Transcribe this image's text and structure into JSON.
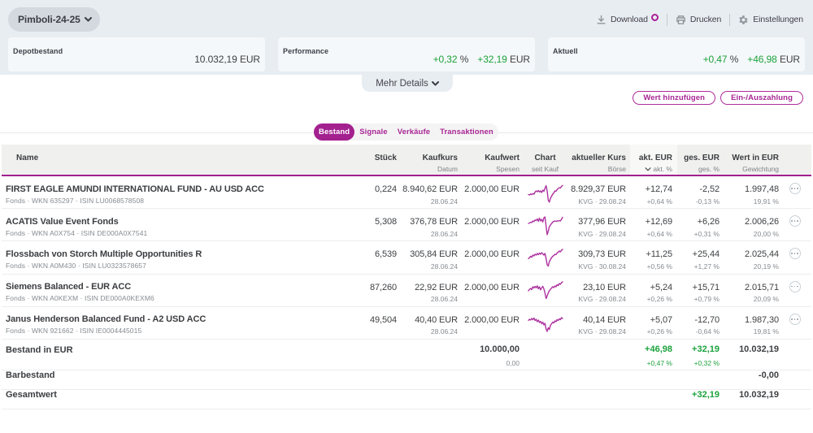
{
  "brand": {
    "magenta": "#a2208f",
    "green": "#1ca23c",
    "red": "#cc2733"
  },
  "banner": {
    "portfolio_selector": {
      "label": "Pimboli-24-25"
    },
    "actions": {
      "download": {
        "label": "Download"
      },
      "print": {
        "label": "Drucken"
      },
      "settings": {
        "label": "Einstellungen"
      }
    },
    "cards": [
      {
        "label": "Depotbestand",
        "value": "10.032,19",
        "unit": "EUR"
      },
      {
        "label": "Performance",
        "pct": "+0,32",
        "pct_unit": "%",
        "abs": "+32,19",
        "abs_unit": "EUR"
      },
      {
        "label": "Aktuell",
        "pct": "+0,47",
        "pct_unit": "%",
        "abs": "+46,98",
        "abs_unit": "EUR"
      }
    ],
    "more_details_label": "Mehr Details"
  },
  "toolbar": {
    "add_value_label": "Wert hinzufügen",
    "payment_label": "Ein-/Auszahlung"
  },
  "tabs": [
    {
      "label": "Bestand"
    },
    {
      "label": "Signale"
    },
    {
      "label": "Verkäufe"
    },
    {
      "label": "Transaktionen"
    }
  ],
  "table": {
    "header": {
      "name": "Name",
      "stueck": "Stück",
      "kaufkurs": "Kaufkurs",
      "kaufkurs2": "Datum",
      "kaufwert": "Kaufwert",
      "kaufwert2": "Spesen",
      "chart": "Chart",
      "chart2": "seit Kauf",
      "kurs": "aktueller Kurs",
      "kurs2": "Börse",
      "akt": "akt. EUR",
      "akt2": "akt. %",
      "ges": "ges. EUR",
      "ges2": "ges. %",
      "wert": "Wert in EUR",
      "wert2": "Gewichtung"
    },
    "rows": [
      {
        "name": "FIRST EAGLE AMUNDI INTERNATIONAL FUND - AU USD ACC",
        "sub": "Fonds · WKN 635297 · ISIN LU0068578508",
        "stueck": "0,224",
        "kaufkurs": "8.940,62 EUR",
        "datum": "28.06.24",
        "kaufwert": "2.000,00 EUR",
        "kurs": "8.929,37 EUR",
        "boerse": "KVG · 29.08.24",
        "akt_eur": "+12,74",
        "akt_pct": "+0,64 %",
        "ges_eur": "-2,52",
        "ges_pct": "-0,13 %",
        "wert": "1.997,48",
        "gew": "19,91 %",
        "spark": [
          0.6,
          0.62,
          0.57,
          0.6,
          0.55,
          0.58,
          0.48,
          0.42,
          0.46,
          0.4,
          0.47,
          0.42,
          0.5,
          0.38,
          0.44,
          0.3,
          0.16,
          0.42,
          0.88,
          0.97,
          0.78,
          0.68,
          0.58,
          0.52,
          0.42,
          0.44,
          0.36,
          0.3,
          0.26,
          0.28,
          0.2,
          0.15
        ]
      },
      {
        "name": "ACATIS Value Event Fonds",
        "sub": "Fonds · WKN A0X754 · ISIN DE000A0X7541",
        "stueck": "5,308",
        "kaufkurs": "376,78 EUR",
        "datum": "28.06.24",
        "kaufwert": "2.000,00 EUR",
        "kurs": "377,96 EUR",
        "boerse": "KVG · 29.08.24",
        "akt_eur": "+12,69",
        "akt_pct": "+0,64 %",
        "ges_eur": "+6,26",
        "ges_pct": "+0,31 %",
        "wert": "2.006,26",
        "gew": "20,00 %",
        "spark": [
          0.42,
          0.4,
          0.36,
          0.38,
          0.3,
          0.33,
          0.25,
          0.28,
          0.2,
          0.32,
          0.16,
          0.3,
          0.22,
          0.35,
          0.14,
          0.1,
          0.55,
          0.97,
          0.8,
          0.58,
          0.5,
          0.42,
          0.36,
          0.32,
          0.3,
          0.32,
          0.3,
          0.3,
          0.28,
          0.3,
          0.22,
          0.12
        ]
      },
      {
        "name": "Flossbach von Storch Multiple Opportunities R",
        "sub": "Fonds · WKN A0M430 · ISIN LU0323578657",
        "stueck": "6,539",
        "kaufkurs": "305,84 EUR",
        "datum": "28.06.24",
        "kaufwert": "2.000,00 EUR",
        "kurs": "309,73 EUR",
        "boerse": "KVG · 30.08.24",
        "akt_eur": "+11,25",
        "akt_pct": "+0,56 %",
        "ges_eur": "+25,44",
        "ges_pct": "+1,27 %",
        "wert": "2.025,44",
        "gew": "20,19 %",
        "spark": [
          0.55,
          0.5,
          0.44,
          0.48,
          0.38,
          0.42,
          0.34,
          0.38,
          0.3,
          0.36,
          0.28,
          0.34,
          0.26,
          0.32,
          0.38,
          0.3,
          0.55,
          0.85,
          0.92,
          0.7,
          0.6,
          0.5,
          0.44,
          0.4,
          0.34,
          0.36,
          0.28,
          0.24,
          0.18,
          0.22,
          0.14,
          0.1
        ]
      },
      {
        "name": "Siemens Balanced - EUR ACC",
        "sub": "Fonds · WKN A0KEXM · ISIN DE000A0KEXM6",
        "stueck": "87,260",
        "kaufkurs": "22,92 EUR",
        "datum": "28.06.24",
        "kaufwert": "2.000,00 EUR",
        "kurs": "23,10 EUR",
        "boerse": "KVG · 29.08.24",
        "akt_eur": "+5,24",
        "akt_pct": "+0,26 %",
        "ges_eur": "+15,71",
        "ges_pct": "+0,79 %",
        "wert": "2.015,71",
        "gew": "20,09 %",
        "spark": [
          0.5,
          0.42,
          0.38,
          0.44,
          0.3,
          0.36,
          0.28,
          0.35,
          0.25,
          0.4,
          0.3,
          0.45,
          0.35,
          0.28,
          0.4,
          0.6,
          0.88,
          0.75,
          0.6,
          0.5,
          0.42,
          0.36,
          0.3,
          0.34,
          0.26,
          0.3,
          0.2,
          0.24,
          0.14,
          0.18,
          0.1,
          0.06
        ]
      },
      {
        "name": "Janus Henderson Balanced Fund - A2 USD ACC",
        "sub": "Fonds · WKN 921662 · ISIN IE0004445015",
        "stueck": "49,504",
        "kaufkurs": "40,40 EUR",
        "datum": "28.06.24",
        "kaufwert": "2.000,00 EUR",
        "kurs": "40,14 EUR",
        "boerse": "KVG · 29.08.24",
        "akt_eur": "+5,07",
        "akt_pct": "+0,26 %",
        "ges_eur": "-12,70",
        "ges_pct": "-0,64 %",
        "wert": "1.987,30",
        "gew": "19,81 %",
        "spark": [
          0.35,
          0.3,
          0.34,
          0.26,
          0.32,
          0.24,
          0.36,
          0.3,
          0.42,
          0.34,
          0.46,
          0.4,
          0.52,
          0.44,
          0.58,
          0.5,
          0.78,
          0.9,
          0.72,
          0.8,
          0.6,
          0.52,
          0.44,
          0.48,
          0.38,
          0.42,
          0.32,
          0.36,
          0.28,
          0.32,
          0.22,
          0.26
        ]
      }
    ],
    "summary": {
      "bestand": {
        "label": "Bestand in EUR",
        "kaufwert": "10.000,00",
        "spesen": "0,00",
        "akt_eur": "+46,98",
        "akt_pct": "+0,47 %",
        "ges_eur": "+32,19",
        "ges_pct": "+0,32 %",
        "wert": "10.032,19"
      },
      "barbestand": {
        "label": "Barbestand",
        "wert": "-0,00"
      },
      "gesamtwert": {
        "label": "Gesamtwert",
        "ges_eur": "+32,19",
        "wert": "10.032,19"
      }
    }
  }
}
